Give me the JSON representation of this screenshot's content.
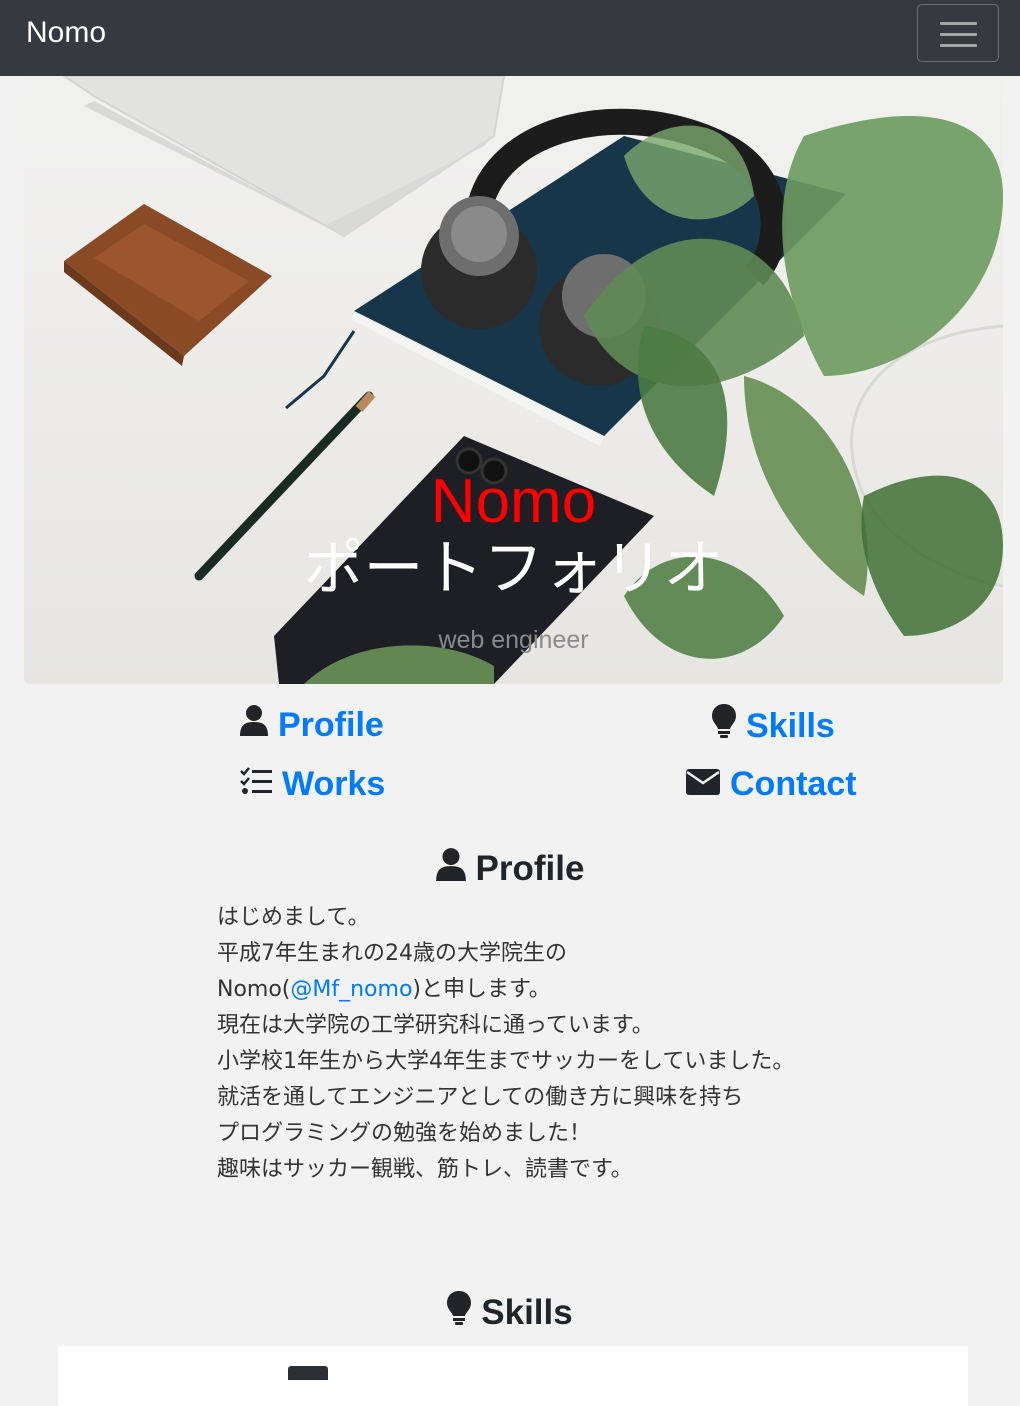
{
  "navbar": {
    "brand": "Nomo",
    "toggler_icon": "hamburger-icon"
  },
  "hero": {
    "title": "Nomo",
    "subtitle": "ポートフォリオ",
    "role": "web engineer",
    "title_color": "#ff0000"
  },
  "quicknav": {
    "profile": {
      "label": "Profile",
      "icon": "user-icon"
    },
    "skills": {
      "label": "Skills",
      "icon": "lightbulb-icon"
    },
    "works": {
      "label": "Works",
      "icon": "tasks-icon"
    },
    "contact": {
      "label": "Contact",
      "icon": "envelope-icon"
    },
    "link_color": "#007bff"
  },
  "profile": {
    "heading": "Profile",
    "lines": {
      "l1": "はじめまして。",
      "l2": "平成7年生まれの24歳の大学院生の",
      "l3_prefix": "Nomo(",
      "l3_link": "@Mf_nomo",
      "l3_suffix": ")と申します。",
      "l4": "現在は大学院の工学研究科に通っています。",
      "l5": "小学校1年生から大学4年生までサッカーをしていました。",
      "l6": "就活を通してエンジニアとしての働き方に興味を持ち",
      "l7": "プログラミングの勉強を始めました！",
      "l8": "趣味はサッカー観戦、筋トレ、読書です。"
    }
  },
  "skills": {
    "heading": "Skills"
  }
}
